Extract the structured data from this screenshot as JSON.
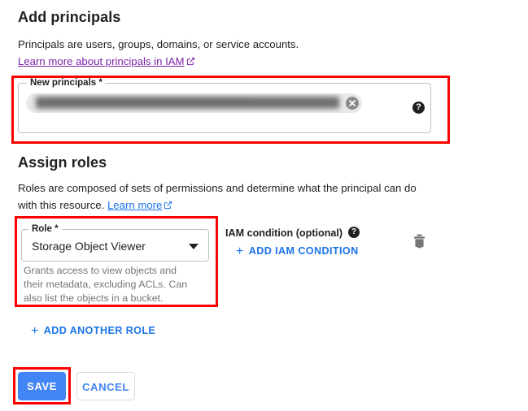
{
  "colors": {
    "accent_blue": "#1a73e8",
    "button_blue": "#4285f4",
    "visited_link_purple": "#7b23a7",
    "annotation_red": "#ff0000",
    "muted_text": "#757575",
    "field_border": "#bdc1c6"
  },
  "add_principals": {
    "title": "Add principals",
    "description_prefix": "Principals are users, groups, domains, or service accounts. ",
    "learn_more_link": "Learn more about principals in IAM",
    "field": {
      "label": "New principals *",
      "chip_value": "█████████████████████████████████████████████████████████████",
      "remove_chip_title": "Remove",
      "help_icon": "help-icon"
    }
  },
  "assign_roles": {
    "title": "Assign roles",
    "description_prefix": "Roles are composed of sets of permissions and determine what the principal can do with this resource. ",
    "learn_more_link": "Learn more",
    "role": {
      "label": "Role *",
      "selected_value": "Storage Object Viewer",
      "dropdown_icon": "chevron-down-icon",
      "hint": "Grants access to view objects and their metadata, excluding ACLs. Can also list the objects in a bucket."
    },
    "iam_condition": {
      "label": "IAM condition (optional)",
      "help_icon": "help-icon",
      "add_button_label": "ADD IAM CONDITION",
      "add_button_icon": "plus-icon"
    },
    "delete_role_icon": "trash-icon",
    "add_another_role_label": "ADD ANOTHER ROLE",
    "add_another_role_icon": "plus-icon"
  },
  "actions": {
    "save_label": "SAVE",
    "cancel_label": "CANCEL"
  },
  "icons": {
    "external_link": "external-link-icon"
  }
}
